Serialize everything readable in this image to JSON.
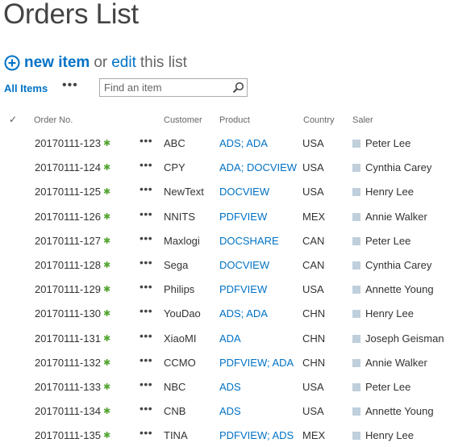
{
  "page": {
    "title": "Orders List"
  },
  "toolbar": {
    "new_item": "new item",
    "or": "or",
    "edit": "edit",
    "this_list": "this list"
  },
  "view": {
    "all_items": "All Items",
    "ellipsis": "•••",
    "search_placeholder": "Find an item"
  },
  "columns": {
    "check": "✓",
    "order_no": "Order No.",
    "customer": "Customer",
    "product": "Product",
    "country": "Country",
    "saler": "Saler"
  },
  "rows": [
    {
      "order_no": "20170111-123",
      "customer": "ABC",
      "product": "ADS; ADA",
      "country": "USA",
      "saler": "Peter Lee"
    },
    {
      "order_no": "20170111-124",
      "customer": "CPY",
      "product": "ADA; DOCVIEW",
      "country": "USA",
      "saler": "Cynthia Carey"
    },
    {
      "order_no": "20170111-125",
      "customer": "NewText",
      "product": "DOCVIEW",
      "country": "USA",
      "saler": "Henry Lee"
    },
    {
      "order_no": "20170111-126",
      "customer": "NNITS",
      "product": "PDFVIEW",
      "country": "MEX",
      "saler": "Annie Walker"
    },
    {
      "order_no": "20170111-127",
      "customer": "Maxlogi",
      "product": "DOCSHARE",
      "country": "CAN",
      "saler": "Peter Lee"
    },
    {
      "order_no": "20170111-128",
      "customer": "Sega",
      "product": "DOCVIEW",
      "country": "CAN",
      "saler": "Cynthia Carey"
    },
    {
      "order_no": "20170111-129",
      "customer": "Philips",
      "product": "PDFVIEW",
      "country": "USA",
      "saler": "Annette Young"
    },
    {
      "order_no": "20170111-130",
      "customer": "YouDao",
      "product": "ADS; ADA",
      "country": "CHN",
      "saler": "Henry Lee"
    },
    {
      "order_no": "20170111-131",
      "customer": "XiaoMI",
      "product": "ADA",
      "country": "CHN",
      "saler": "Joseph Geisman"
    },
    {
      "order_no": "20170111-132",
      "customer": "CCMO",
      "product": "PDFVIEW; ADA",
      "country": "CHN",
      "saler": "Annie Walker"
    },
    {
      "order_no": "20170111-133",
      "customer": "NBC",
      "product": "ADS",
      "country": "USA",
      "saler": "Peter Lee"
    },
    {
      "order_no": "20170111-134",
      "customer": "CNB",
      "product": "ADS",
      "country": "USA",
      "saler": "Annette Young"
    },
    {
      "order_no": "20170111-135",
      "customer": "TINA",
      "product": "PDFVIEW; ADS",
      "country": "MEX",
      "saler": "Henry Lee"
    }
  ],
  "row_ellipsis": "•••",
  "new_marker": "✱",
  "colors": {
    "accent": "#0072c6",
    "new_marker": "#53a531",
    "person_square": "#bfcfdc"
  },
  "icons": {
    "new_item": "plus-circle-icon",
    "search": "search-icon",
    "check": "check-icon",
    "person": "person-presence-icon",
    "new_marker": "new-item-marker-icon"
  }
}
